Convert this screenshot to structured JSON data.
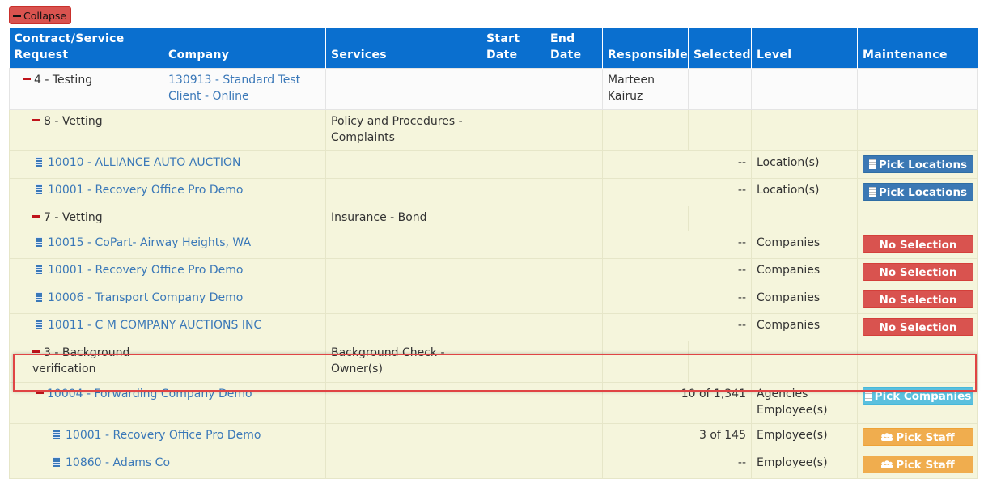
{
  "collapse_label": "Collapse",
  "headers": {
    "request": "Contract/Service Request",
    "company": "Company",
    "services": "Services",
    "start": "Start Date",
    "end": "End Date",
    "responsible": "Responsible",
    "selected": "Selected",
    "level": "Level",
    "maintenance": "Maintenance"
  },
  "rows": [
    {
      "request": "4 - Testing",
      "company": "130913 - Standard Test Client - Online",
      "services": "",
      "responsible": "Marteen Kairuz",
      "selected": "",
      "level": "",
      "button": ""
    },
    {
      "request": "8 - Vetting",
      "company": "",
      "services": "Policy and Procedures - Complaints",
      "responsible": "",
      "selected": "",
      "level": "",
      "button": ""
    },
    {
      "request": "10010 - ALLIANCE AUTO AUCTION",
      "selected": "--",
      "level": "Location(s)",
      "button": "Pick Locations"
    },
    {
      "request": "10001 - Recovery Office Pro Demo",
      "selected": "--",
      "level": "Location(s)",
      "button": "Pick Locations"
    },
    {
      "request": "7 - Vetting",
      "services": "Insurance - Bond",
      "selected": "",
      "level": "",
      "button": ""
    },
    {
      "request": "10015 - CoPart- Airway Heights, WA",
      "selected": "--",
      "level": "Companies",
      "button": "No Selection"
    },
    {
      "request": "10001 - Recovery Office Pro Demo",
      "selected": "--",
      "level": "Companies",
      "button": "No Selection"
    },
    {
      "request": "10006 - Transport Company Demo",
      "selected": "--",
      "level": "Companies",
      "button": "No Selection"
    },
    {
      "request": "10011 - C M COMPANY AUCTIONS INC",
      "selected": "--",
      "level": "Companies",
      "button": "No Selection"
    },
    {
      "request": "3 - Background verification",
      "services": "Background Check - Owner(s)",
      "selected": "",
      "level": "",
      "button": ""
    },
    {
      "request": "10004 - Forwarding Company Demo",
      "selected": "10 of 1,341",
      "level": "Agencies Employee(s)",
      "button": "Pick Companies"
    },
    {
      "request": "10001 - Recovery Office Pro Demo",
      "selected": "3 of 145",
      "level": "Employee(s)",
      "button": "Pick Staff"
    },
    {
      "request": "10860 - Adams Co",
      "selected": "--",
      "level": "Employee(s)",
      "button": "Pick Staff"
    }
  ],
  "colors": {
    "header": "#0a6fcf",
    "row_bg": "#f5f5dc",
    "link": "#3a78b8",
    "btn_blue": "#3b78b4",
    "btn_red": "#d9534f",
    "btn_cyan": "#5bc0de",
    "btn_orange": "#f0ad4e",
    "highlight": "#e04444"
  },
  "icons": {
    "collapse": "minus-icon",
    "building": "building-icon",
    "staff": "users-icon"
  }
}
